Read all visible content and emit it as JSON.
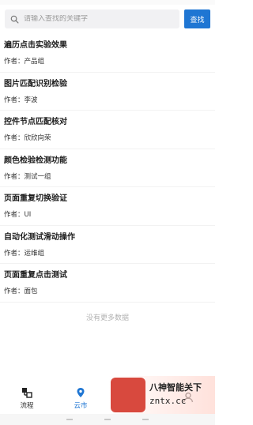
{
  "search": {
    "placeholder": "请输入查找的关键字",
    "button_label": "查找"
  },
  "items": [
    {
      "title": "遍历点击实验效果",
      "author": "作者：产品组"
    },
    {
      "title": "图片匹配识别检验",
      "author": "作者：李波"
    },
    {
      "title": "控件节点匹配核对",
      "author": "作者：欣欣向荣"
    },
    {
      "title": "颜色检验检测功能",
      "author": "作者：测试一组"
    },
    {
      "title": "页面重复切换验证",
      "author": "作者：UI"
    },
    {
      "title": "自动化测试滑动操作",
      "author": "作者：运维组"
    },
    {
      "title": "页面重复点击测试",
      "author": "作者：面包"
    }
  ],
  "no_more": "没有更多数据",
  "tabs": [
    {
      "label": "流程",
      "icon": "flow-icon"
    },
    {
      "label": "云市",
      "icon": "location-pin-icon"
    },
    {
      "label": "",
      "icon": "category-icon"
    },
    {
      "label": "",
      "icon": "user-icon"
    }
  ],
  "colors": {
    "accent": "#1f76d3"
  },
  "watermark": {
    "text": "八神智能关下",
    "sub": "zntx.cc"
  }
}
